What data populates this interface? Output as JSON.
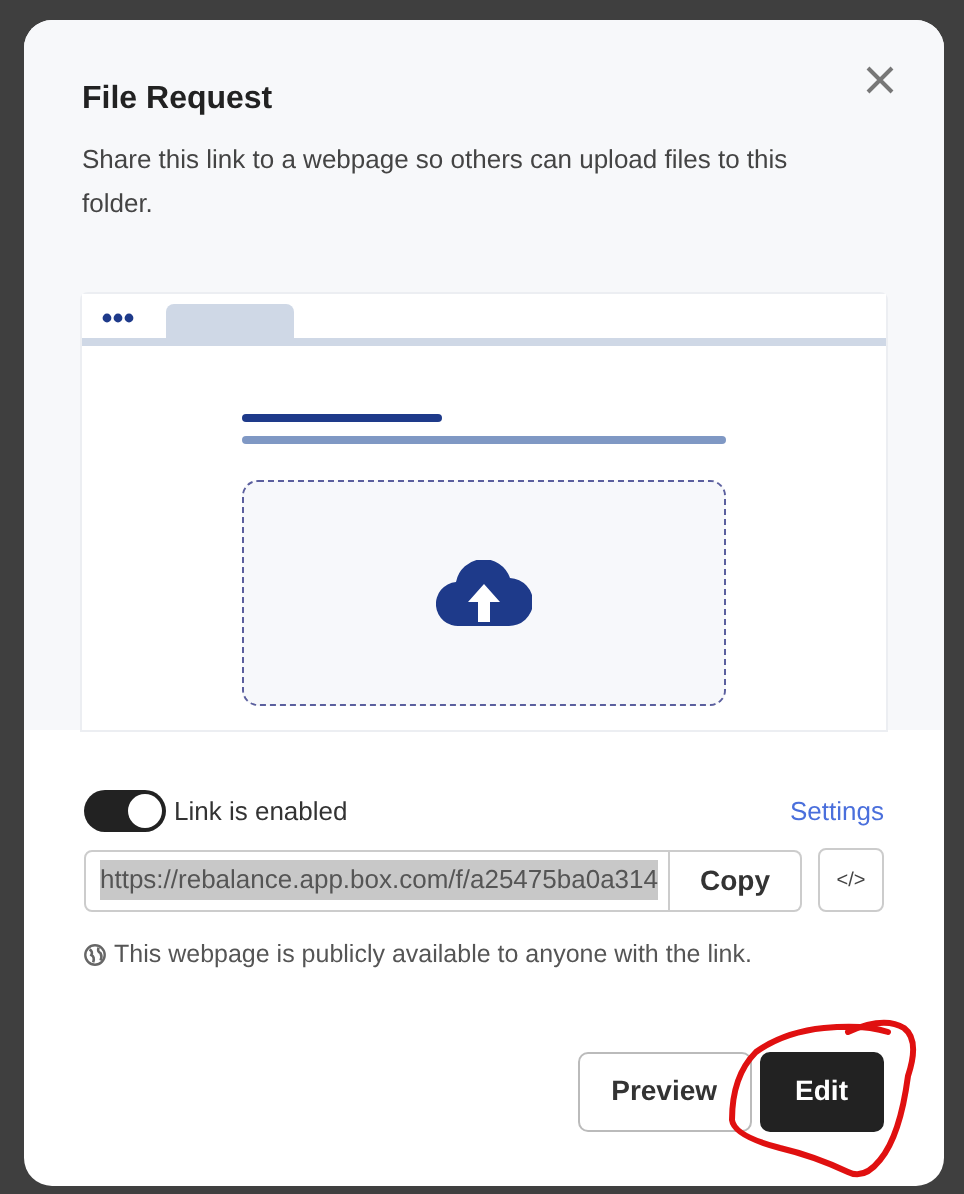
{
  "dialog": {
    "title": "File Request",
    "description": "Share this link to a webpage so others can upload files to this folder."
  },
  "link_toggle": {
    "label": "Link is enabled",
    "on": true
  },
  "settings_link": "Settings",
  "url_field": {
    "value": "https://rebalance.app.box.com/f/a25475ba0a314",
    "selected": true
  },
  "copy_button": "Copy",
  "embed_button": "</>",
  "notice": "This webpage is publicly available to anyone with the link.",
  "buttons": [
    {
      "label": "Preview",
      "kind": "secondary"
    },
    {
      "label": "Edit",
      "kind": "primary"
    }
  ]
}
